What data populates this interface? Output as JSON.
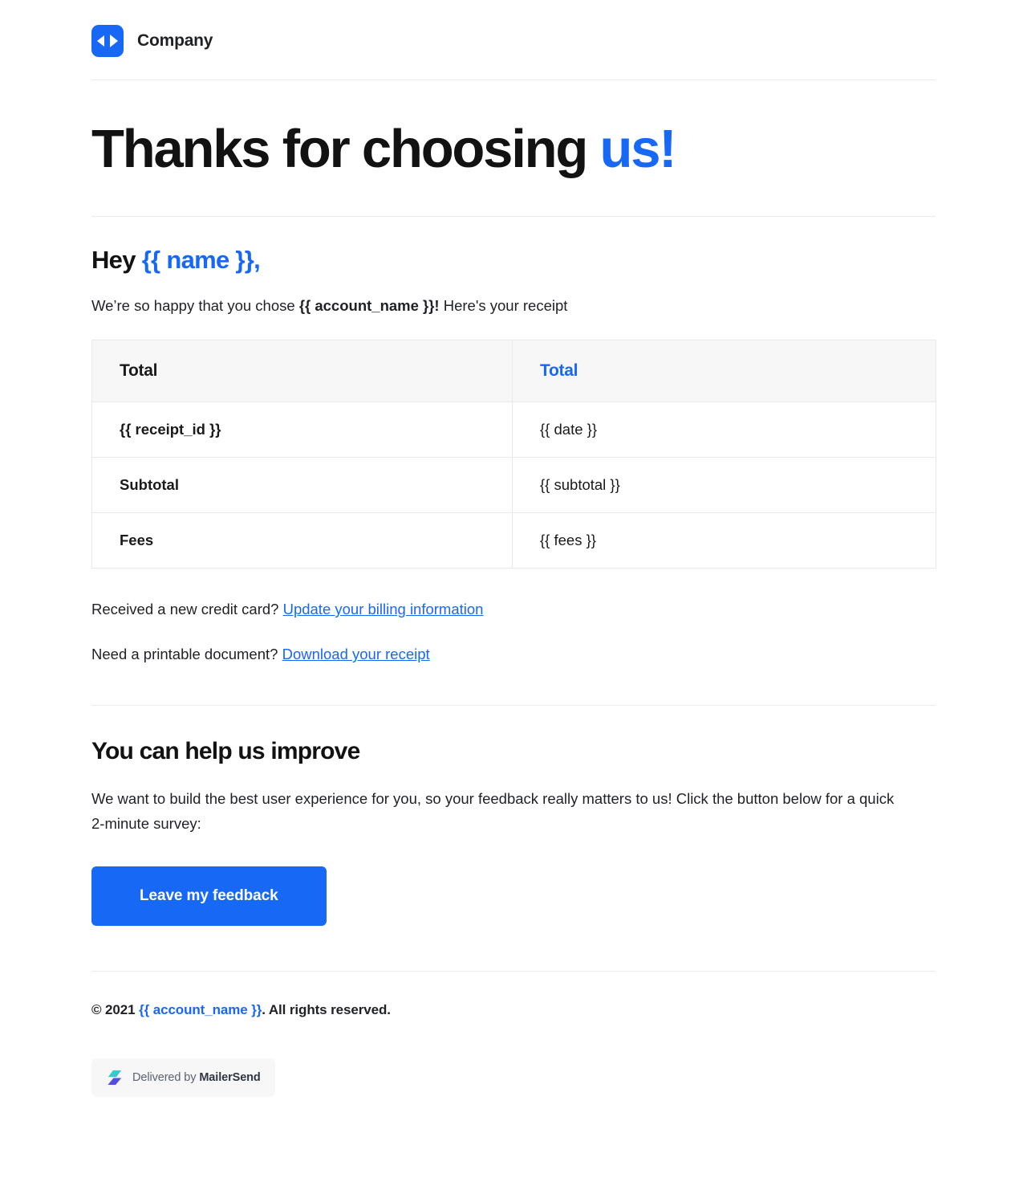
{
  "header": {
    "brand_name": "Company",
    "logo_icon": "play-pair-logo-icon"
  },
  "hero": {
    "title_main": "Thanks for choosing ",
    "title_accent": "us!"
  },
  "greeting": {
    "hey": "Hey ",
    "name_token": "{{ name }},",
    "intro_prefix": "We’re so happy that you chose ",
    "intro_bold": "{{ account_name }}!",
    "intro_suffix": " Here's your receipt"
  },
  "receipt": {
    "headers": [
      "Total",
      "Total"
    ],
    "rows": [
      {
        "label": "{{ receipt_id }}",
        "value": "{{ date }}"
      },
      {
        "label": "Subtotal",
        "value": "{{ subtotal }}"
      },
      {
        "label": "Fees",
        "value": "{{ fees }}"
      }
    ]
  },
  "links": {
    "billing_prefix": "Received a new credit card? ",
    "billing_link": "Update your billing information",
    "receipt_prefix": "Need a printable document? ",
    "receipt_link": "Download your receipt"
  },
  "improve": {
    "title": "You can help us improve",
    "copy": "We want to build the best user experience for you, so your feedback really matters to us! Click the button below for a quick 2-minute survey:",
    "cta_label": "Leave my feedback"
  },
  "footer": {
    "copyright_prefix": "© 2021 ",
    "copyright_account": "{{ account_name }}",
    "copyright_suffix": ". All rights reserved.",
    "badge_prefix": "Delivered by ",
    "badge_brand": "MailerSend",
    "badge_icon": "mailersend-bolt-icon"
  },
  "colors": {
    "accent_blue": "#1868f6",
    "text": "#1f2124",
    "rule": "#ececec",
    "table_header_bg": "#f7f7f7",
    "badge_bg": "#f7f7f8"
  }
}
